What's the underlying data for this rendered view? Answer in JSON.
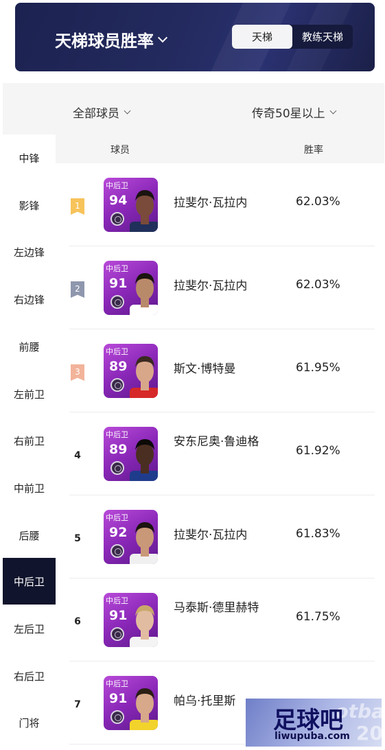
{
  "header": {
    "title": "天梯球员胜率",
    "tabs": [
      {
        "label": "天梯",
        "active": true
      },
      {
        "label": "教练天梯",
        "active": false
      }
    ]
  },
  "filters": {
    "players": "全部球员",
    "level": "传奇50星以上"
  },
  "table": {
    "col_player": "球员",
    "col_rate": "胜率"
  },
  "sidebar": {
    "items": [
      "中锋",
      "影锋",
      "左边锋",
      "右边锋",
      "前腰",
      "左前卫",
      "右前卫",
      "中前卫",
      "后腰",
      "中后卫",
      "左后卫",
      "右后卫",
      "门将"
    ],
    "active": "中后卫"
  },
  "rows": [
    {
      "rank": "1",
      "pos": "中后卫",
      "ovr": "94",
      "name": "拉斐尔·瓦拉内",
      "rate": "62.03%",
      "badge": "#f7c35b"
    },
    {
      "rank": "2",
      "pos": "中后卫",
      "ovr": "91",
      "name": "拉斐尔·瓦拉内",
      "rate": "62.03%",
      "badge": "#8e97ad"
    },
    {
      "rank": "3",
      "pos": "中后卫",
      "ovr": "89",
      "name": "斯文·博特曼",
      "rate": "61.95%",
      "badge": "#f2b39a"
    },
    {
      "rank": "4",
      "pos": "中后卫",
      "ovr": "89",
      "name": "安东尼奥·鲁迪格",
      "rate": "61.92%"
    },
    {
      "rank": "5",
      "pos": "中后卫",
      "ovr": "92",
      "name": "拉斐尔·瓦拉内",
      "rate": "61.83%"
    },
    {
      "rank": "6",
      "pos": "中后卫",
      "ovr": "91",
      "name": "马泰斯·德里赫特",
      "rate": "61.75%"
    },
    {
      "rank": "7",
      "pos": "中后卫",
      "ovr": "91",
      "name": "帕乌·托里斯",
      "rate": ""
    }
  ],
  "watermark": {
    "title": "足球吧",
    "url": "liwupuba.com",
    "bg_text_1": "otba",
    "bg_text_2": "20"
  },
  "colors": {
    "header_bg": "#232a5e",
    "active_sidebar": "#10142c",
    "card_purple": "#8a27b8"
  }
}
